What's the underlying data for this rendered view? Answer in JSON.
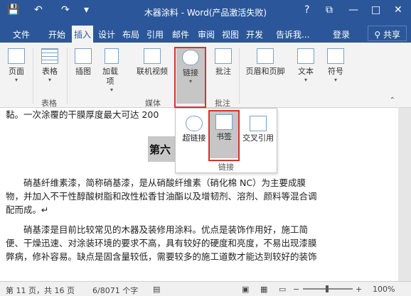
{
  "window": {
    "title": "木器涂料 - Word(产品激活失败)",
    "controls": {
      "help": "?",
      "restore": "⧉",
      "minimize": "—",
      "maximize": "□",
      "close": "✕"
    }
  },
  "quick_access": {
    "save": "💾",
    "undo": "↶",
    "redo": "↷",
    "customize": "▾"
  },
  "tabs": [
    "文件",
    "开始",
    "插入",
    "设计",
    "布局",
    "引用",
    "邮件",
    "审阅",
    "视图",
    "开发",
    "告诉我...",
    "登录"
  ],
  "share": "共享",
  "ribbon": {
    "buttons": {
      "page": "页面",
      "table": "表格",
      "illustration": "插图",
      "addin": "加载项",
      "online_video": "联机视频",
      "link": "链接",
      "comment": "批注",
      "header_footer": "页眉和页脚",
      "text": "文本",
      "symbol": "符号"
    },
    "groups": {
      "table": "表格",
      "media": "媒体",
      "comment": "批注"
    }
  },
  "popup": {
    "hyperlink": "超链接",
    "bookmark": "书签",
    "cross_ref": "交叉引用",
    "group": "链接"
  },
  "document": {
    "line0": "黏。一次涂覆的干膜厚度最大可达 200",
    "heading": "第六",
    "p1_l1": "　　硝基纤维素漆，简称硝基漆，是从硝酸纤维素（硝化棉 NC）为主要成膜",
    "p1_l2": "物，并加入不干性醇酸树脂和改性松香甘油酯以及增韧剂、溶剂、颜料等混合调",
    "p1_l3": "配而成。↵",
    "p2_l1": "　　硝基漆是目前比较常见的木器及装修用涂料。优点是装饰作用好，施工简",
    "p2_l2": "便、干燥迅速、对涂装环境的要求不高，具有较好的硬度和亮度，不易出现漆膜",
    "p2_l3": "弊病，修补容易。缺点是固含量较低，需要较多的施工道数才能达到较好的装饰"
  },
  "status": {
    "page": "第 11 页，共 16 页",
    "words": "6/8071 个字",
    "zoom": "100%"
  },
  "colors": {
    "accent": "#2b579a",
    "highlight": "#d9312b"
  }
}
